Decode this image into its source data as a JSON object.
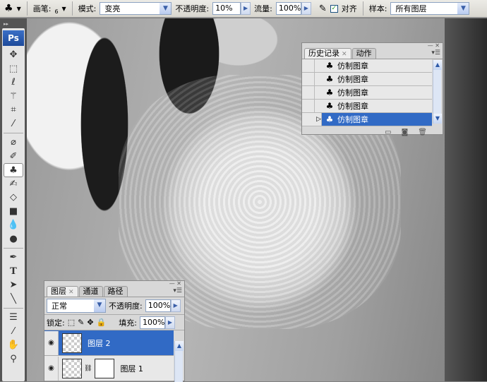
{
  "options_bar": {
    "tool_icon": "clone-stamp-icon",
    "brush_label": "画笔:",
    "brush_size": "6",
    "mode_label": "模式:",
    "mode_value": "变亮",
    "opacity_label": "不透明度:",
    "opacity_value": "10%",
    "flow_label": "流量:",
    "flow_value": "100%",
    "aligned_label": "对齐",
    "aligned_checked": true,
    "sample_label": "样本:",
    "sample_value": "所有图层"
  },
  "toolbox": {
    "logo": "Ps",
    "tools": [
      "move",
      "marquee",
      "lasso",
      "magic-wand",
      "crop",
      "slice",
      "healing-brush",
      "brush",
      "clone-stamp",
      "history-brush",
      "eraser",
      "gradient",
      "blur",
      "dodge",
      "pen",
      "type",
      "path-selection",
      "line",
      "notes",
      "eyedropper",
      "hand",
      "zoom"
    ],
    "active": "clone-stamp"
  },
  "history_panel": {
    "tabs": [
      "历史记录",
      "动作"
    ],
    "items": [
      {
        "label": "仿制图章"
      },
      {
        "label": "仿制图章"
      },
      {
        "label": "仿制图章"
      },
      {
        "label": "仿制图章"
      },
      {
        "label": "仿制图章",
        "selected": true
      }
    ]
  },
  "layers_panel": {
    "tabs": [
      "图层",
      "通道",
      "路径"
    ],
    "blend_mode": "正常",
    "opacity_label": "不透明度:",
    "opacity_value": "100%",
    "lock_label": "锁定:",
    "fill_label": "填充:",
    "fill_value": "100%",
    "layers": [
      {
        "name": "图层 2",
        "selected": true
      },
      {
        "name": "图层 1"
      }
    ]
  },
  "colors": {
    "selection": "#316ac5",
    "accent": "#3b6fc6"
  }
}
